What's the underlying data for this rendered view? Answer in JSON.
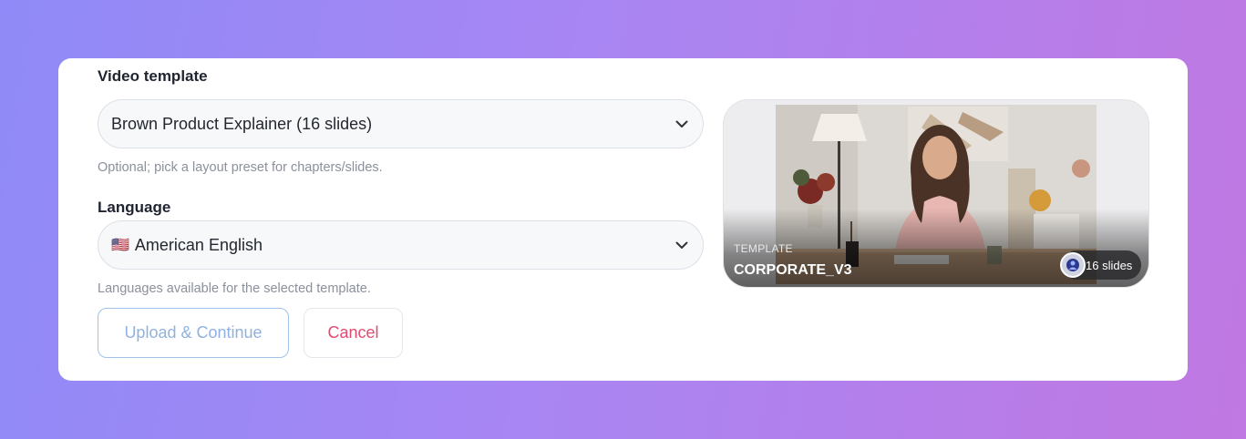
{
  "template_field": {
    "label": "Video template",
    "selected": "Brown Product Explainer (16 slides)",
    "hint": "Optional; pick a layout preset for chapters/slides."
  },
  "language_field": {
    "label": "Language",
    "flag": "🇺🇸",
    "selected": "American English",
    "hint": "Languages available for the selected template."
  },
  "actions": {
    "upload_label": "Upload & Continue",
    "cancel_label": "Cancel"
  },
  "preview": {
    "kicker": "TEMPLATE",
    "name": "CORPORATE_V3",
    "slides_badge": "16 slides"
  },
  "colors": {
    "accent_blue": "#8fb2e0",
    "cancel_red": "#e24a6f"
  },
  "icons": {
    "dropdown": "chevron-down-icon"
  }
}
